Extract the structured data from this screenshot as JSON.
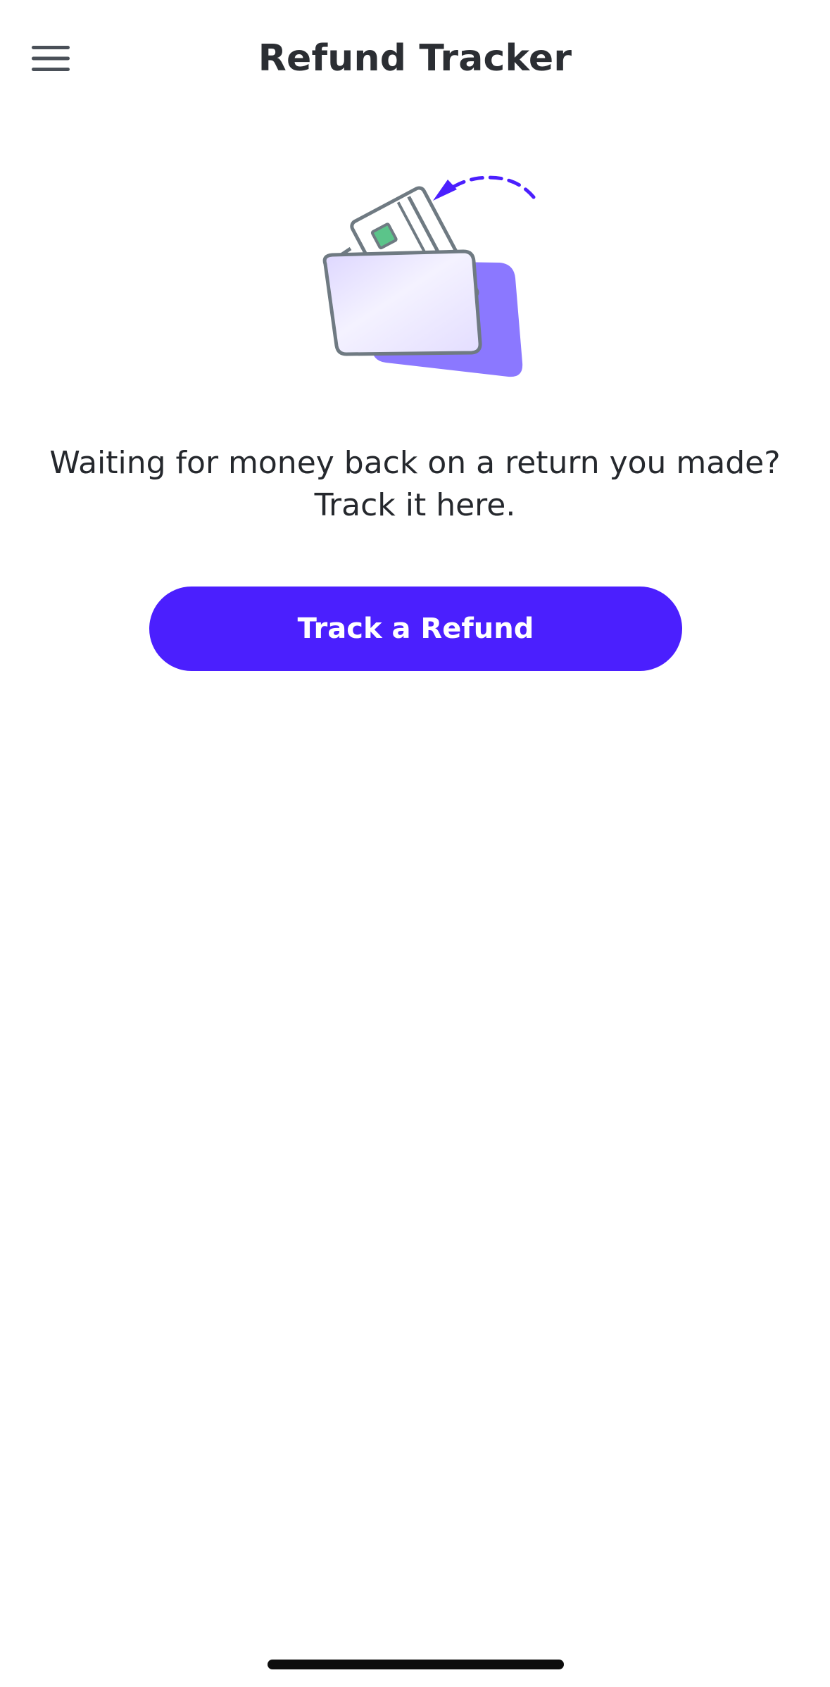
{
  "header": {
    "title": "Refund Tracker",
    "menu_icon": "hamburger-menu-icon"
  },
  "hero": {
    "illustration": "wallet-with-card-refund-illustration",
    "message_line1": "Waiting for money back on a return you made?",
    "message_line2": "Track it here."
  },
  "actions": {
    "track_refund_label": "Track a Refund"
  },
  "colors": {
    "accent": "#4b1ffe",
    "text": "#2b2e33",
    "illustration_purple": "#8b78ff",
    "illustration_card_fill": "#e6e1ff",
    "illustration_stroke": "#6f7a82",
    "illustration_chip": "#5bc48a"
  }
}
